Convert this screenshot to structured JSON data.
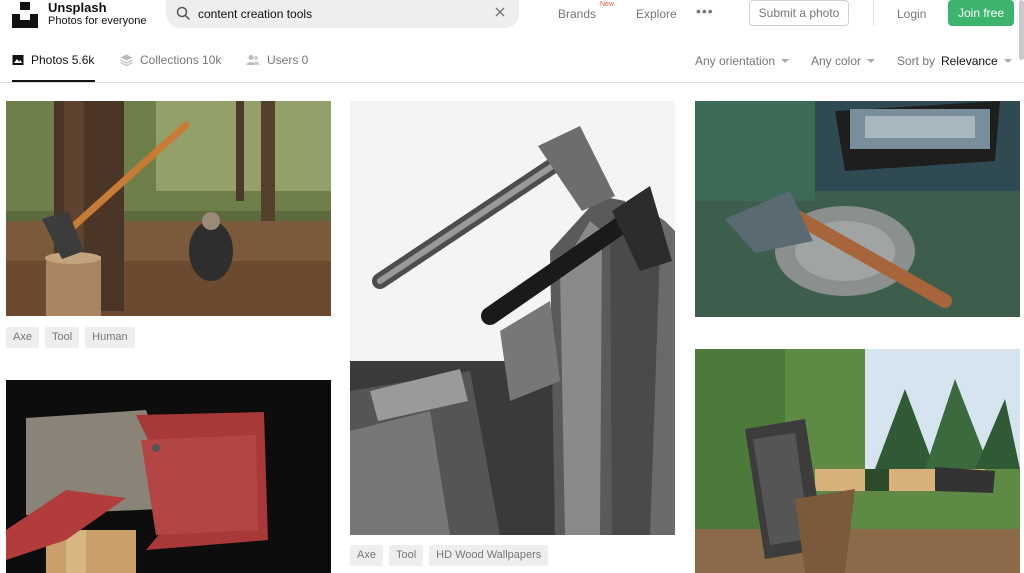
{
  "brand": {
    "name": "Unsplash",
    "tagline": "Photos for everyone"
  },
  "search": {
    "value": "content creation tools"
  },
  "nav": {
    "brands": "Brands",
    "brands_badge": "New",
    "explore": "Explore",
    "more": "•••",
    "submit": "Submit a photo",
    "login": "Login",
    "join": "Join free"
  },
  "tabs": [
    {
      "label": "Photos 5.6k",
      "icon": "image-icon"
    },
    {
      "label": "Collections 10k",
      "icon": "collections-icon"
    },
    {
      "label": "Users 0",
      "icon": "users-icon"
    }
  ],
  "filters": {
    "orientation": "Any orientation",
    "color": "Any color",
    "sort_prefix": "Sort by",
    "sort_value": "Relevance"
  },
  "photos": [
    {
      "tags": [
        "Axe",
        "Tool",
        "Human"
      ]
    },
    {
      "tags": [
        "Axe",
        "Tool",
        "HD Wood Wallpapers"
      ]
    }
  ],
  "colors": {
    "join_button": "#3cb46e",
    "new_badge": "#e25c3d"
  }
}
